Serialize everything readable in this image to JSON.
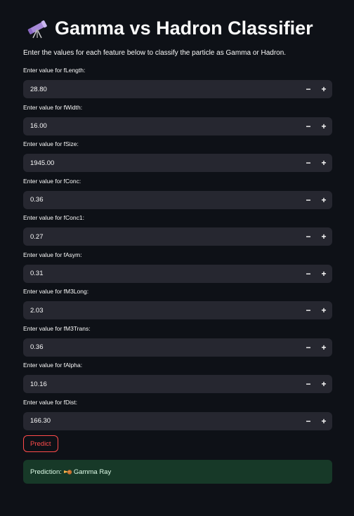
{
  "header": {
    "title": "Gamma vs Hadron Classifier",
    "icon": "telescope-icon",
    "subtitle": "Enter the values for each feature below to classify the particle as Gamma or Hadron."
  },
  "fields": [
    {
      "label": "Enter value for fLength:",
      "value": "28.80"
    },
    {
      "label": "Enter value for fWidth:",
      "value": "16.00"
    },
    {
      "label": "Enter value for fSize:",
      "value": "1945.00"
    },
    {
      "label": "Enter value for fConc:",
      "value": "0.36"
    },
    {
      "label": "Enter value for fConc1:",
      "value": "0.27"
    },
    {
      "label": "Enter value for fAsym:",
      "value": "0.31"
    },
    {
      "label": "Enter value for fM3Long:",
      "value": "2.03"
    },
    {
      "label": "Enter value for fM3Trans:",
      "value": "0.36"
    },
    {
      "label": "Enter value for fAlpha:",
      "value": "10.16"
    },
    {
      "label": "Enter value for fDist:",
      "value": "166.30"
    }
  ],
  "stepper": {
    "minus": "−",
    "plus": "+"
  },
  "predict_label": "Predict",
  "result": {
    "prefix": "Prediction:",
    "icon": "comet-icon",
    "value": "Gamma Ray"
  },
  "colors": {
    "background": "#0e1117",
    "input_background": "#262730",
    "accent": "#ff4b4b",
    "success_background": "#173928"
  }
}
